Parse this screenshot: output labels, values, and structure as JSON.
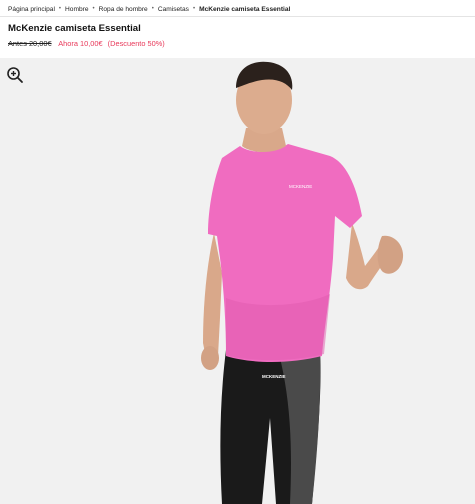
{
  "breadcrumb": {
    "items": [
      "Página principal",
      "Hombre",
      "Ropa de hombre",
      "Camisetas"
    ],
    "current": "McKenzie camiseta Essential"
  },
  "product": {
    "title": "McKenzie camiseta Essential",
    "old_price": "Antes 20,00€",
    "new_price": "Ahora 10,00€",
    "discount": "(Descuento 50%)"
  },
  "image": {
    "shirt_logo": "MCKENZIE",
    "pants_logo": "MCKENZIE",
    "shirt_color": "#f06cc0",
    "pants_color": "#1a1a1a",
    "pants_panel_color": "#4a4a4a",
    "background_color": "#f1f1f1"
  },
  "icons": {
    "zoom": "zoom-in-icon"
  },
  "colors": {
    "sale": "#e8395a"
  }
}
